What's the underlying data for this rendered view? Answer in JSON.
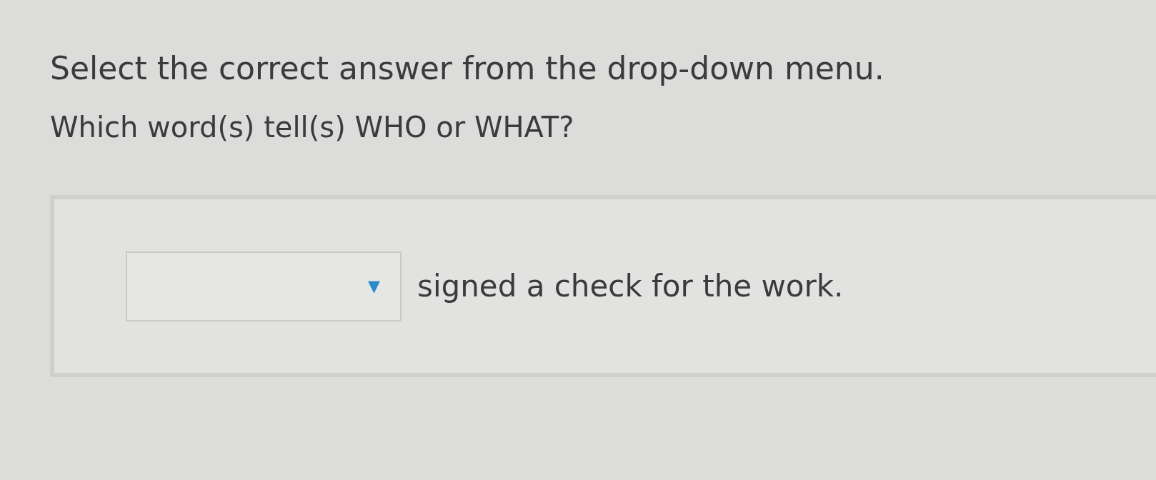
{
  "instruction": "Select the correct answer from the drop-down menu.",
  "question": "Which word(s) tell(s) WHO or WHAT?",
  "sentence": {
    "dropdown": {
      "arrow": "▼"
    },
    "text": "signed a check for the work."
  }
}
